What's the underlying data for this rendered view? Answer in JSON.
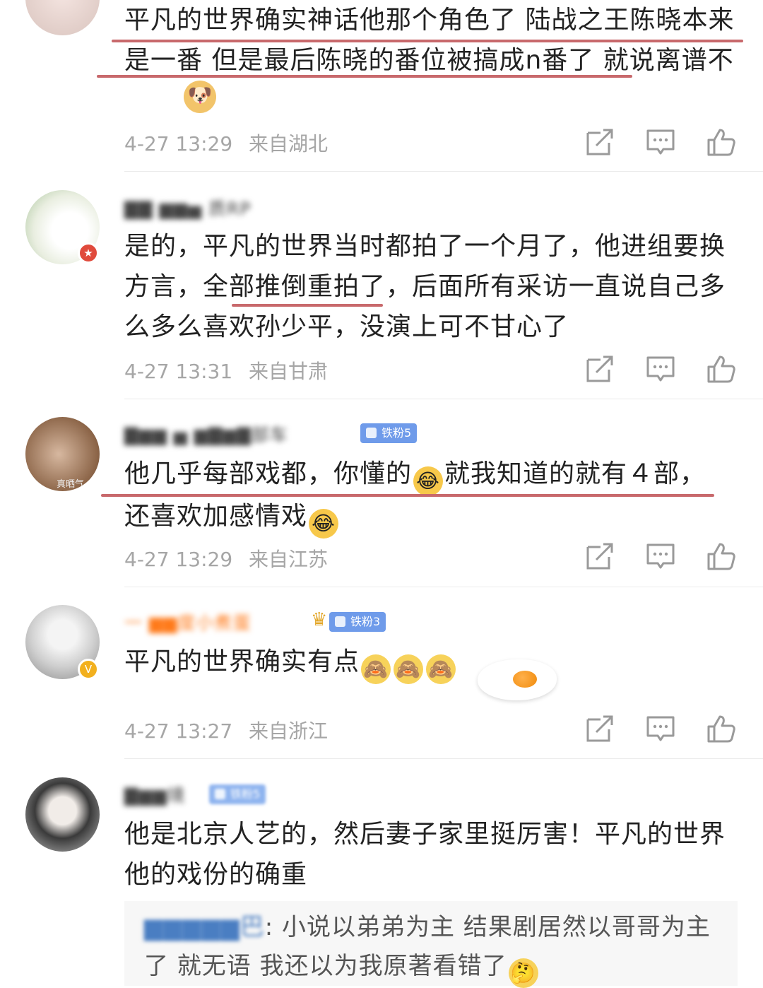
{
  "comments": [
    {
      "name": "",
      "text_parts": [
        "平凡的世界确实神话他那个角色了 陆战之王陈晓本来是一番 但是最后陈晓的番位被搞成n番了 就说离谱不"
      ],
      "time": "4-27 13:29",
      "location": "来自湖北"
    },
    {
      "name": "▇▇ ▆▆▅ 质RP",
      "text_parts": [
        "是的，平凡的世界当时都拍了一个月了，他进组要换方言，",
        "全部推倒重拍了",
        "，后面所有采访一直说自己多么多么喜欢孙少平，没演上可不甘心了"
      ],
      "time": "4-27 13:31",
      "location": "来自甘肃"
    },
    {
      "name": "▇▆▆ ▅ ▆▇▆▇部车",
      "fan_badge": "铁粉5",
      "avatar_caption": "真晒气",
      "text_a": "他几乎每部戏都，你懂的",
      "text_b": "就我知道的就有４部，",
      "text_c": "还喜欢加感情戏",
      "time": "4-27 13:29",
      "location": "来自江苏"
    },
    {
      "name": "一 ▆▆度小煮蛋",
      "fan_badge": "铁粉3",
      "text": "平凡的世界确实有点",
      "time": "4-27 13:27",
      "location": "来自浙江"
    },
    {
      "name": "▇▆▆境",
      "fan_badge": "铁粉5",
      "text": "他是北京人艺的，然后妻子家里挺厉害！平凡的世界他的戏份的确重",
      "reply_user": "▆▆▆▆▆巴",
      "reply_text": "小说以弟弟为主 结果剧居然以哥哥为主了 就无语 我还以为我原著看错了"
    }
  ],
  "icons": [
    "share-icon",
    "comment-icon",
    "like-icon"
  ],
  "colors": {
    "underline": "#c8696c",
    "fan_badge": "#6f9bea",
    "link": "#4a7ec2",
    "meta": "#a6a6a6"
  }
}
